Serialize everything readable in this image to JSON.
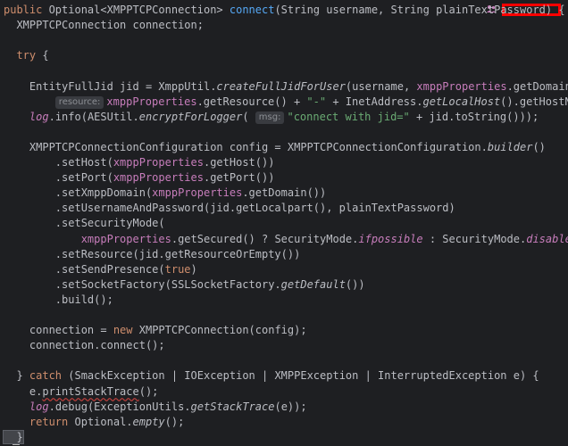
{
  "editor": {
    "lines": [
      [
        {
          "t": "public ",
          "c": "kw"
        },
        {
          "t": "Optional<XMPPTCPConnection> ",
          "c": "plain"
        },
        {
          "t": "connect",
          "c": "fn"
        },
        {
          "t": "(String username, String plainTextPassword) {",
          "c": "plain"
        }
      ],
      [
        {
          "t": "  XMPPTCPConnection connection;",
          "c": "plain"
        }
      ],
      [],
      [
        {
          "t": "  try",
          "c": "kw"
        },
        {
          "t": " {",
          "c": "plain"
        }
      ],
      [],
      [
        {
          "t": "    EntityFullJid jid = XmppUtil.",
          "c": "plain"
        },
        {
          "t": "createFullJidForUser",
          "c": "ital"
        },
        {
          "t": "(username, ",
          "c": "plain"
        },
        {
          "t": "xmppProperties",
          "c": "fld"
        },
        {
          "t": ".getDomain(),",
          "c": "plain"
        }
      ],
      [
        {
          "t": "        ",
          "c": "plain"
        },
        {
          "t": "resource:",
          "c": "hint"
        },
        {
          "t": "xmppProperties",
          "c": "fld"
        },
        {
          "t": ".getResource() + ",
          "c": "plain"
        },
        {
          "t": "\"-\"",
          "c": "str"
        },
        {
          "t": " + InetAddress.",
          "c": "plain"
        },
        {
          "t": "getLocalHost",
          "c": "ital"
        },
        {
          "t": "().getHostName());",
          "c": "plain"
        }
      ],
      [
        {
          "t": "    ",
          "c": "plain"
        },
        {
          "t": "log",
          "c": "ital-fld"
        },
        {
          "t": ".info(AESUtil.",
          "c": "plain"
        },
        {
          "t": "encryptForLogger",
          "c": "ital"
        },
        {
          "t": "( ",
          "c": "plain"
        },
        {
          "t": "msg:",
          "c": "hint"
        },
        {
          "t": "\"connect with jid=\"",
          "c": "str"
        },
        {
          "t": " + jid.toString()));",
          "c": "plain"
        }
      ],
      [],
      [
        {
          "t": "    XMPPTCPConnectionConfiguration config = XMPPTCPConnectionConfiguration.",
          "c": "plain"
        },
        {
          "t": "builder",
          "c": "ital"
        },
        {
          "t": "()",
          "c": "plain"
        }
      ],
      [
        {
          "t": "        .setHost(",
          "c": "plain"
        },
        {
          "t": "xmppProperties",
          "c": "fld"
        },
        {
          "t": ".getHost())",
          "c": "plain"
        }
      ],
      [
        {
          "t": "        .setPort(",
          "c": "plain"
        },
        {
          "t": "xmppProperties",
          "c": "fld"
        },
        {
          "t": ".getPort())",
          "c": "plain"
        }
      ],
      [
        {
          "t": "        .setXmppDomain(",
          "c": "plain"
        },
        {
          "t": "xmppProperties",
          "c": "fld"
        },
        {
          "t": ".getDomain())",
          "c": "plain"
        }
      ],
      [
        {
          "t": "        .setUsernameAndPassword(jid.getLocalpart(), plainTextPassword)",
          "c": "plain"
        }
      ],
      [
        {
          "t": "        .setSecurityMode(",
          "c": "plain"
        }
      ],
      [
        {
          "t": "            ",
          "c": "plain"
        },
        {
          "t": "xmppProperties",
          "c": "fld"
        },
        {
          "t": ".getSecured() ? SecurityMode.",
          "c": "plain"
        },
        {
          "t": "ifpossible",
          "c": "ital-fld"
        },
        {
          "t": " : SecurityMode.",
          "c": "plain"
        },
        {
          "t": "disabled",
          "c": "ital-fld"
        },
        {
          "t": ")",
          "c": "plain"
        }
      ],
      [
        {
          "t": "        .setResource(jid.getResourceOrEmpty())",
          "c": "plain"
        }
      ],
      [
        {
          "t": "        .setSendPresence(",
          "c": "plain"
        },
        {
          "t": "true",
          "c": "kw"
        },
        {
          "t": ")",
          "c": "plain"
        }
      ],
      [
        {
          "t": "        .setSocketFactory(SSLSocketFactory.",
          "c": "plain"
        },
        {
          "t": "getDefault",
          "c": "ital"
        },
        {
          "t": "())",
          "c": "plain"
        }
      ],
      [
        {
          "t": "        .build();",
          "c": "plain"
        }
      ],
      [],
      [
        {
          "t": "    connection = ",
          "c": "plain"
        },
        {
          "t": "new",
          "c": "kw"
        },
        {
          "t": " XMPPTCPConnection(config);",
          "c": "plain"
        }
      ],
      [
        {
          "t": "    connection.connect();",
          "c": "plain"
        }
      ],
      [],
      [
        {
          "t": "  } ",
          "c": "plain"
        },
        {
          "t": "catch",
          "c": "kw"
        },
        {
          "t": " (SmackException | IOException | XMPPException | InterruptedException e) {",
          "c": "plain"
        }
      ],
      [
        {
          "t": "    e.",
          "c": "plain"
        },
        {
          "t": "printStackTrace",
          "c": "squiggle"
        },
        {
          "t": "();",
          "c": "plain"
        }
      ],
      [
        {
          "t": "    ",
          "c": "plain"
        },
        {
          "t": "log",
          "c": "ital-fld"
        },
        {
          "t": ".debug(ExceptionUtils.",
          "c": "plain"
        },
        {
          "t": "getStackTrace",
          "c": "ital"
        },
        {
          "t": "(e));",
          "c": "plain"
        }
      ],
      [
        {
          "t": "    ",
          "c": "plain"
        },
        {
          "t": "return",
          "c": "kw"
        },
        {
          "t": " Optional.",
          "c": "plain"
        },
        {
          "t": "empty",
          "c": "ital"
        },
        {
          "t": "();",
          "c": "plain"
        }
      ],
      [
        {
          "t": "  }",
          "c": "brace-hl"
        }
      ]
    ]
  },
  "icons": {
    "collaborators": "users-icon",
    "intention": "lightbulb-icon"
  },
  "colors": {
    "background": "#1e1f22",
    "keyword": "#cf8e6d",
    "method": "#56a8f5",
    "string": "#6aab73",
    "field": "#c77dbb",
    "text": "#bcbec4",
    "redaction": "#ff0000"
  }
}
